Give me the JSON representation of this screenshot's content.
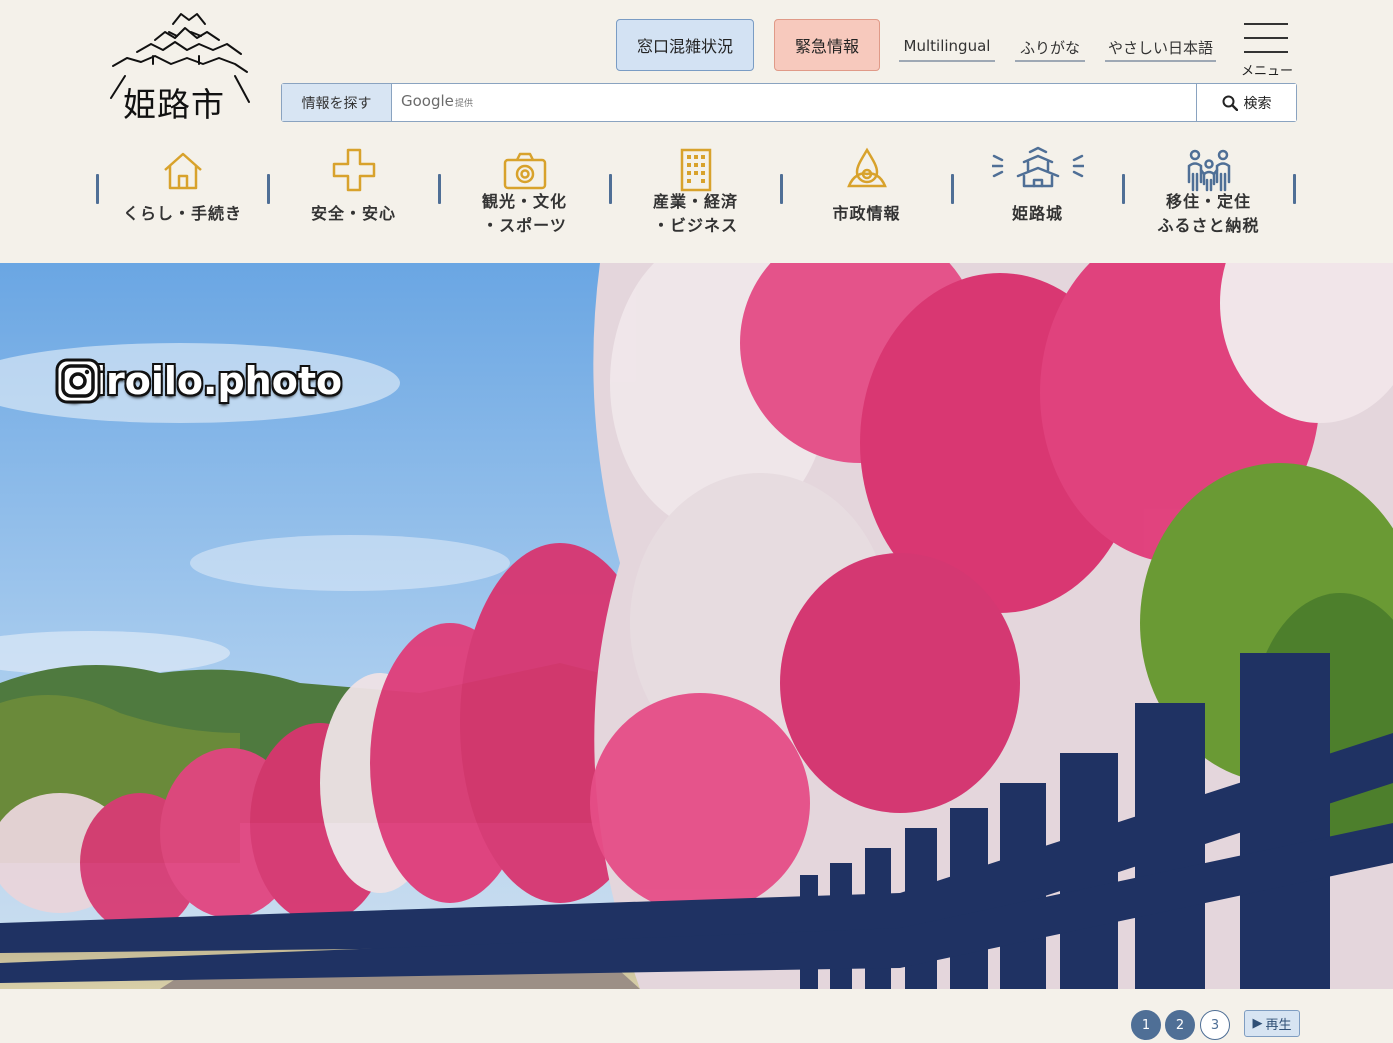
{
  "site": {
    "logo_text": "姫路市"
  },
  "header": {
    "wait_status_label": "窓口混雑状況",
    "emergency_label": "緊急情報",
    "links": {
      "multilingual": "Multilingual",
      "furigana": "ふりがな",
      "easy_japanese": "やさしい日本語"
    },
    "menu_label": "メニュー"
  },
  "search": {
    "label": "情報を探す",
    "google_brand": "Google",
    "google_sub": "提供",
    "placeholder": "",
    "button_label": "検索"
  },
  "nav": {
    "items": [
      {
        "icon": "house-icon",
        "line1": "くらし・手続き",
        "line2": ""
      },
      {
        "icon": "cross-icon",
        "line1": "安全・安心",
        "line2": ""
      },
      {
        "icon": "camera-icon",
        "line1": "観光・文化",
        "line2": "・スポーツ"
      },
      {
        "icon": "building-icon",
        "line1": "産業・経済",
        "line2": "・ビジネス"
      },
      {
        "icon": "city-emblem-icon",
        "line1": "市政情報",
        "line2": ""
      },
      {
        "icon": "castle-icon",
        "line1": "姫路城",
        "line2": ""
      },
      {
        "icon": "family-icon",
        "line1": "移住・定住",
        "line2": "ふるさと納税"
      }
    ],
    "icon_color": "#d8a22c",
    "accent_color": "#4f6f96"
  },
  "hero": {
    "instagram_icon": "instagram-icon",
    "instagram_handle": "@iroilo.photo"
  },
  "slider": {
    "pages": [
      "1",
      "2",
      "3"
    ],
    "current_pages": [
      "1",
      "2"
    ],
    "play_label": "再生"
  }
}
